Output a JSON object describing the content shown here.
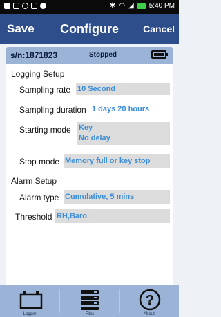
{
  "status_bar": {
    "time": "5:40 PM"
  },
  "title_bar": {
    "save": "Save",
    "title": "Configure",
    "cancel": "Cancel"
  },
  "device": {
    "serial": "s/n:1871823",
    "status": "Stopped",
    "battery_icon": "battery-full-icon"
  },
  "logging_setup": {
    "heading": "Logging Setup",
    "sampling_rate": {
      "label": "Sampling rate",
      "value": "10 Second"
    },
    "sampling_duration": {
      "label": "Sampling duration",
      "value": "1 days 20 hours"
    },
    "starting_mode": {
      "label": "Starting mode",
      "value_line1": "Key",
      "value_line2": "No delay"
    },
    "stop_mode": {
      "label": "Stop mode",
      "value": "Memory full or key stop"
    }
  },
  "alarm_setup": {
    "heading": "Alarm Setup",
    "alarm_type": {
      "label": "Alarm type",
      "value": "Cumulative, 5 mins"
    },
    "threshold": {
      "label": "Threshold",
      "value": "RH,Baro"
    }
  },
  "bottom_nav": [
    {
      "label": "Logger",
      "icon": "logger-icon"
    },
    {
      "label": "Files",
      "icon": "files-icon"
    },
    {
      "label": "About",
      "icon": "question-icon"
    }
  ],
  "colors": {
    "title_bar": "#2e4d8b",
    "device_bar": "#9ab3d6",
    "value_text": "#3b8dd8",
    "value_box": "#dcdcdc",
    "nav_bar": "#9ab3d6"
  }
}
